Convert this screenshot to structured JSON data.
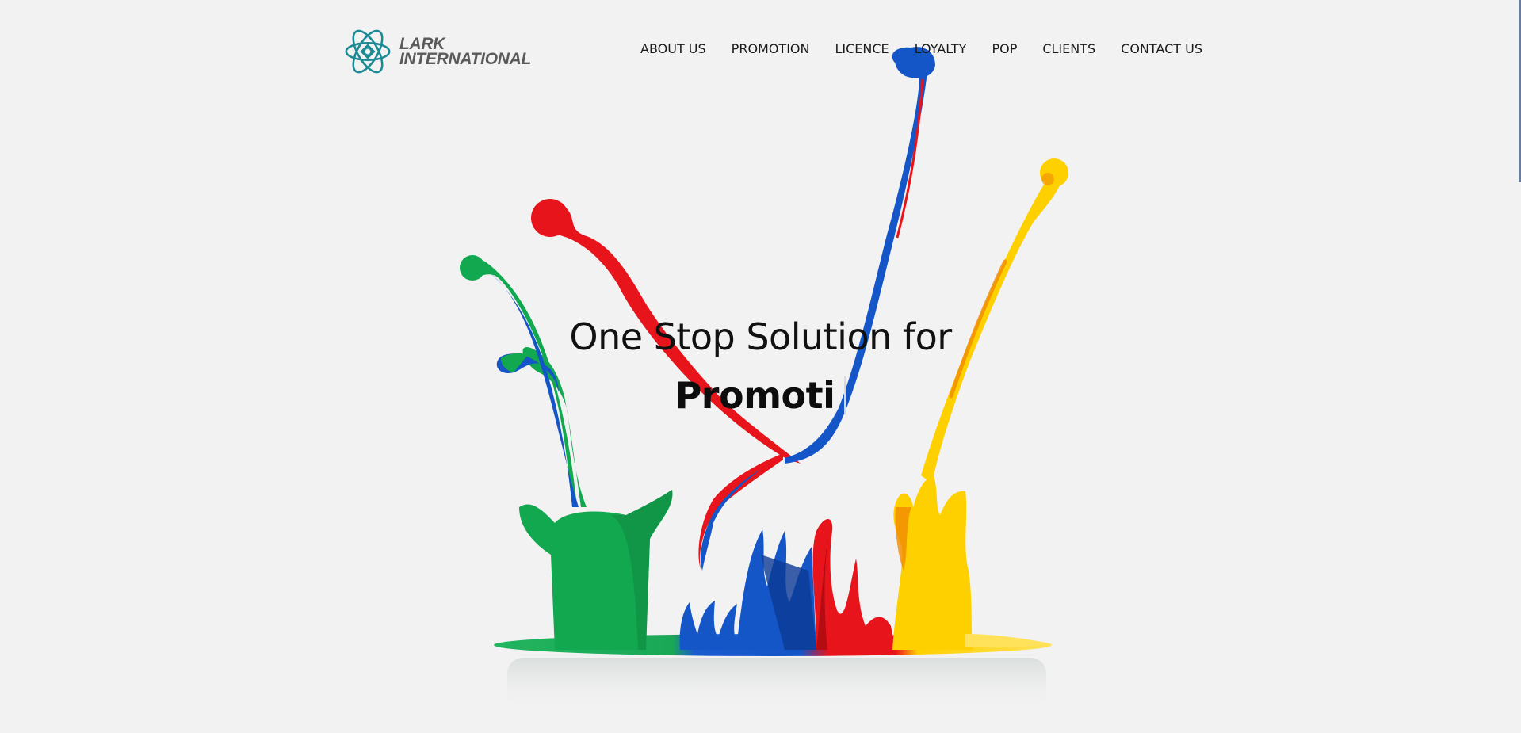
{
  "brand": {
    "name_line1": "LARK",
    "name_line2": "INTERNATIONAL",
    "logo_color": "#1a8a94",
    "text_color": "#5a5a5a"
  },
  "nav": {
    "items": [
      {
        "label": "ABOUT US"
      },
      {
        "label": "PROMOTION"
      },
      {
        "label": "LICENCE"
      },
      {
        "label": "LOYALTY"
      },
      {
        "label": "POP"
      },
      {
        "label": "CLIENTS"
      },
      {
        "label": "CONTACT US"
      }
    ]
  },
  "hero": {
    "headline": "One Stop Solution for",
    "typed_text": "Promoti",
    "paint_colors": {
      "green": "#12a84f",
      "blue": "#1456c8",
      "red": "#e8141c",
      "yellow": "#ffd000"
    }
  },
  "colors": {
    "background": "#f2f2f2",
    "text": "#111111"
  }
}
